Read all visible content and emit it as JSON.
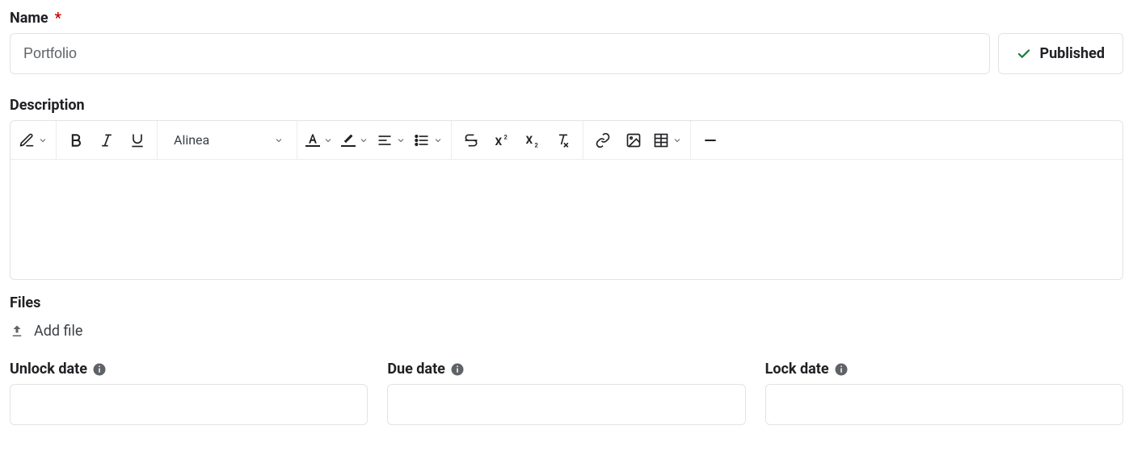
{
  "name": {
    "label": "Name",
    "value": "Portfolio"
  },
  "status": {
    "label": "Published"
  },
  "description": {
    "label": "Description",
    "style_select": "Alinea",
    "content": ""
  },
  "files": {
    "label": "Files",
    "add_label": "Add file"
  },
  "dates": {
    "unlock": {
      "label": "Unlock date",
      "value": ""
    },
    "due": {
      "label": "Due date",
      "value": ""
    },
    "lock": {
      "label": "Lock date",
      "value": ""
    }
  }
}
